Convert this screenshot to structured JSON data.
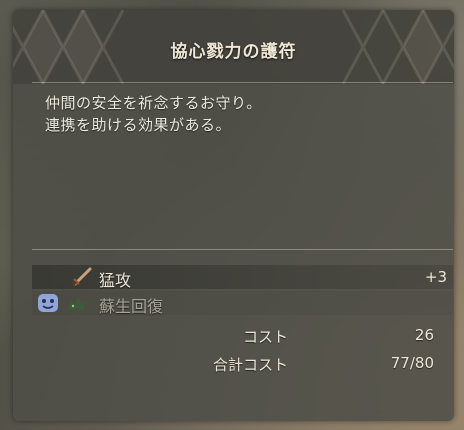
{
  "item": {
    "title": "協心戮力の護符",
    "description_lines": [
      "仲間の安全を祈念するお守り。",
      "連携を助ける効果がある。"
    ]
  },
  "skills": [
    {
      "name": "猛攻",
      "value": "+3",
      "icon": "sword-icon",
      "dimmed": false
    },
    {
      "name": "蘇生回復",
      "value": "",
      "icon": "beast-icon",
      "dimmed": true
    }
  ],
  "stats": {
    "cost_label": "コスト",
    "cost_value": "26",
    "total_label": "合計コスト",
    "total_value": "77/80"
  },
  "colors": {
    "text": "#ece6d8",
    "panel": "#4e4e48",
    "accent_blue": "#8fa4d8"
  }
}
